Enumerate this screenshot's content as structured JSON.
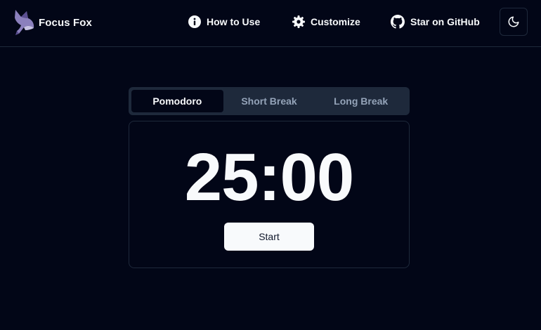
{
  "header": {
    "brand_name": "Focus Fox",
    "nav": {
      "how_to_use": "How to Use",
      "customize": "Customize",
      "github": "Star on GitHub"
    }
  },
  "tabs": [
    {
      "label": "Pomodoro",
      "active": true
    },
    {
      "label": "Short Break",
      "active": false
    },
    {
      "label": "Long Break",
      "active": false
    }
  ],
  "timer": {
    "display": "25:00",
    "start_label": "Start"
  },
  "icons": {
    "logo": "fox-logo-icon",
    "how_to_use": "info-icon",
    "customize": "gear-icon",
    "github": "github-icon",
    "theme": "moon-icon"
  },
  "colors": {
    "background": "#020617",
    "border": "#1e293b",
    "text": "#f8fafc",
    "muted_text": "#94a3b8",
    "logo_accent": "#7c6fae"
  }
}
